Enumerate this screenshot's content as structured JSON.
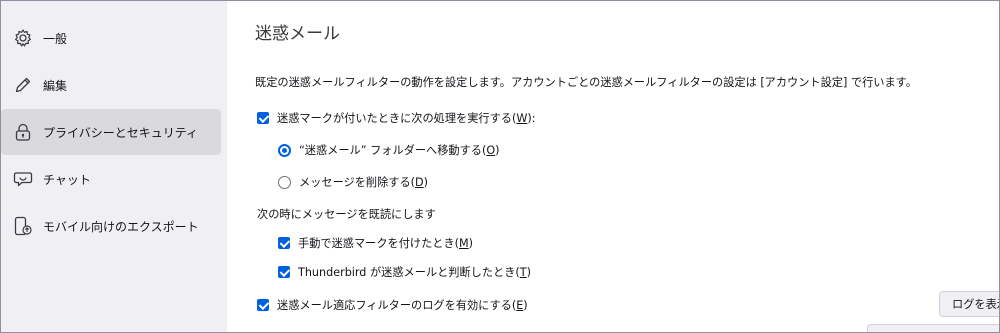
{
  "sidebar": {
    "items": [
      {
        "label": "一般",
        "icon": "gear-icon"
      },
      {
        "label": "編集",
        "icon": "pencil-icon"
      },
      {
        "label": "プライバシーとセキュリティ",
        "icon": "lock-icon",
        "selected": true
      },
      {
        "label": "チャット",
        "icon": "chat-icon"
      },
      {
        "label": "モバイル向けのエクスポート",
        "icon": "mobile-export-icon"
      }
    ]
  },
  "main": {
    "heading": "迷惑メール",
    "description": "既定の迷惑メールフィルターの動作を設定します。アカウントごとの迷惑メールフィルターの設定は [アカウント設定] で行います。",
    "junk_mark": {
      "label": "迷惑マークが付いたときに次の処理を実行する(",
      "key": "W",
      "suffix": "):",
      "checked": true
    },
    "move_option": {
      "label": "“迷惑メール” フォルダーへ移動する(",
      "key": "O",
      "suffix": ")",
      "selected": true
    },
    "delete_option": {
      "label": "メッセージを削除する(",
      "key": "D",
      "suffix": ")",
      "selected": false
    },
    "mark_read_heading": "次の時にメッセージを既読にします",
    "manual_mark": {
      "label": "手動で迷惑マークを付けたとき(",
      "key": "M",
      "suffix": ")",
      "checked": true
    },
    "auto_mark": {
      "label": "Thunderbird が迷惑メールと判断したとき(",
      "key": "T",
      "suffix": ")",
      "checked": true
    },
    "log_option": {
      "label": "迷惑メール適応フィルターのログを有効にする(",
      "key": "E",
      "suffix": ")",
      "checked": true
    },
    "show_log_button": "ログを表示"
  }
}
